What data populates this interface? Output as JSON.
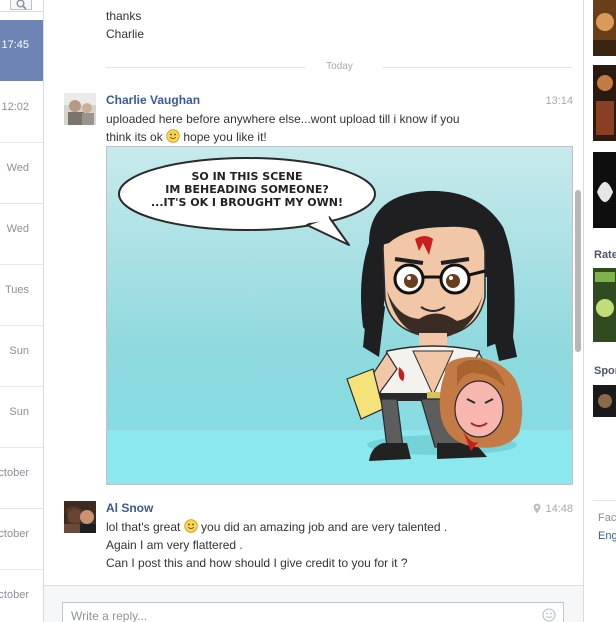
{
  "conversation_list": {
    "items": [
      {
        "time": "17:45",
        "active": true
      },
      {
        "time": "12:02"
      },
      {
        "time": "Wed"
      },
      {
        "time": "Wed"
      },
      {
        "time": "Tues"
      },
      {
        "time": "Sun"
      },
      {
        "time": "Sun"
      },
      {
        "time": "ctober"
      },
      {
        "time": "ctober"
      },
      {
        "time": "ctober"
      }
    ]
  },
  "thread": {
    "previous_message": {
      "line1": "thanks",
      "line2": "Charlie"
    },
    "day_separator": "Today",
    "messages": [
      {
        "sender": "Charlie Vaughan",
        "time": "13:14",
        "text_a": "uploaded here before anywhere else...wont upload till i know if you",
        "text_b": "think its ok",
        "text_c": " hope you like it!",
        "attachment": {
          "speech_line1": "SO IN THIS SCENE",
          "speech_line2": "IM BEHEADING SOMEONE?",
          "speech_line3": "...IT'S OK I BROUGHT MY OWN!"
        }
      },
      {
        "sender": "Al Snow",
        "time": "14:48",
        "text_a": "lol that's great",
        "text_b": " you did an amazing job and are very talented .",
        "text_c": "Again I am very flattered .",
        "text_d": "Can I post this and how should I give credit to you for it ?"
      }
    ]
  },
  "right_sidebar": {
    "section_rate": "Rate",
    "section_sponsored": "Spon",
    "footer_fac": "Fac",
    "footer_eng": "Eng"
  },
  "reply": {
    "placeholder": "Write a reply..."
  },
  "colors": {
    "accent": "#3b5998",
    "active_conversation": "#6d84b4",
    "comic_background": "#8fd9de"
  },
  "icons": [
    "search-icon",
    "smiley-icon",
    "location-pin-icon",
    "emoji-icon"
  ]
}
